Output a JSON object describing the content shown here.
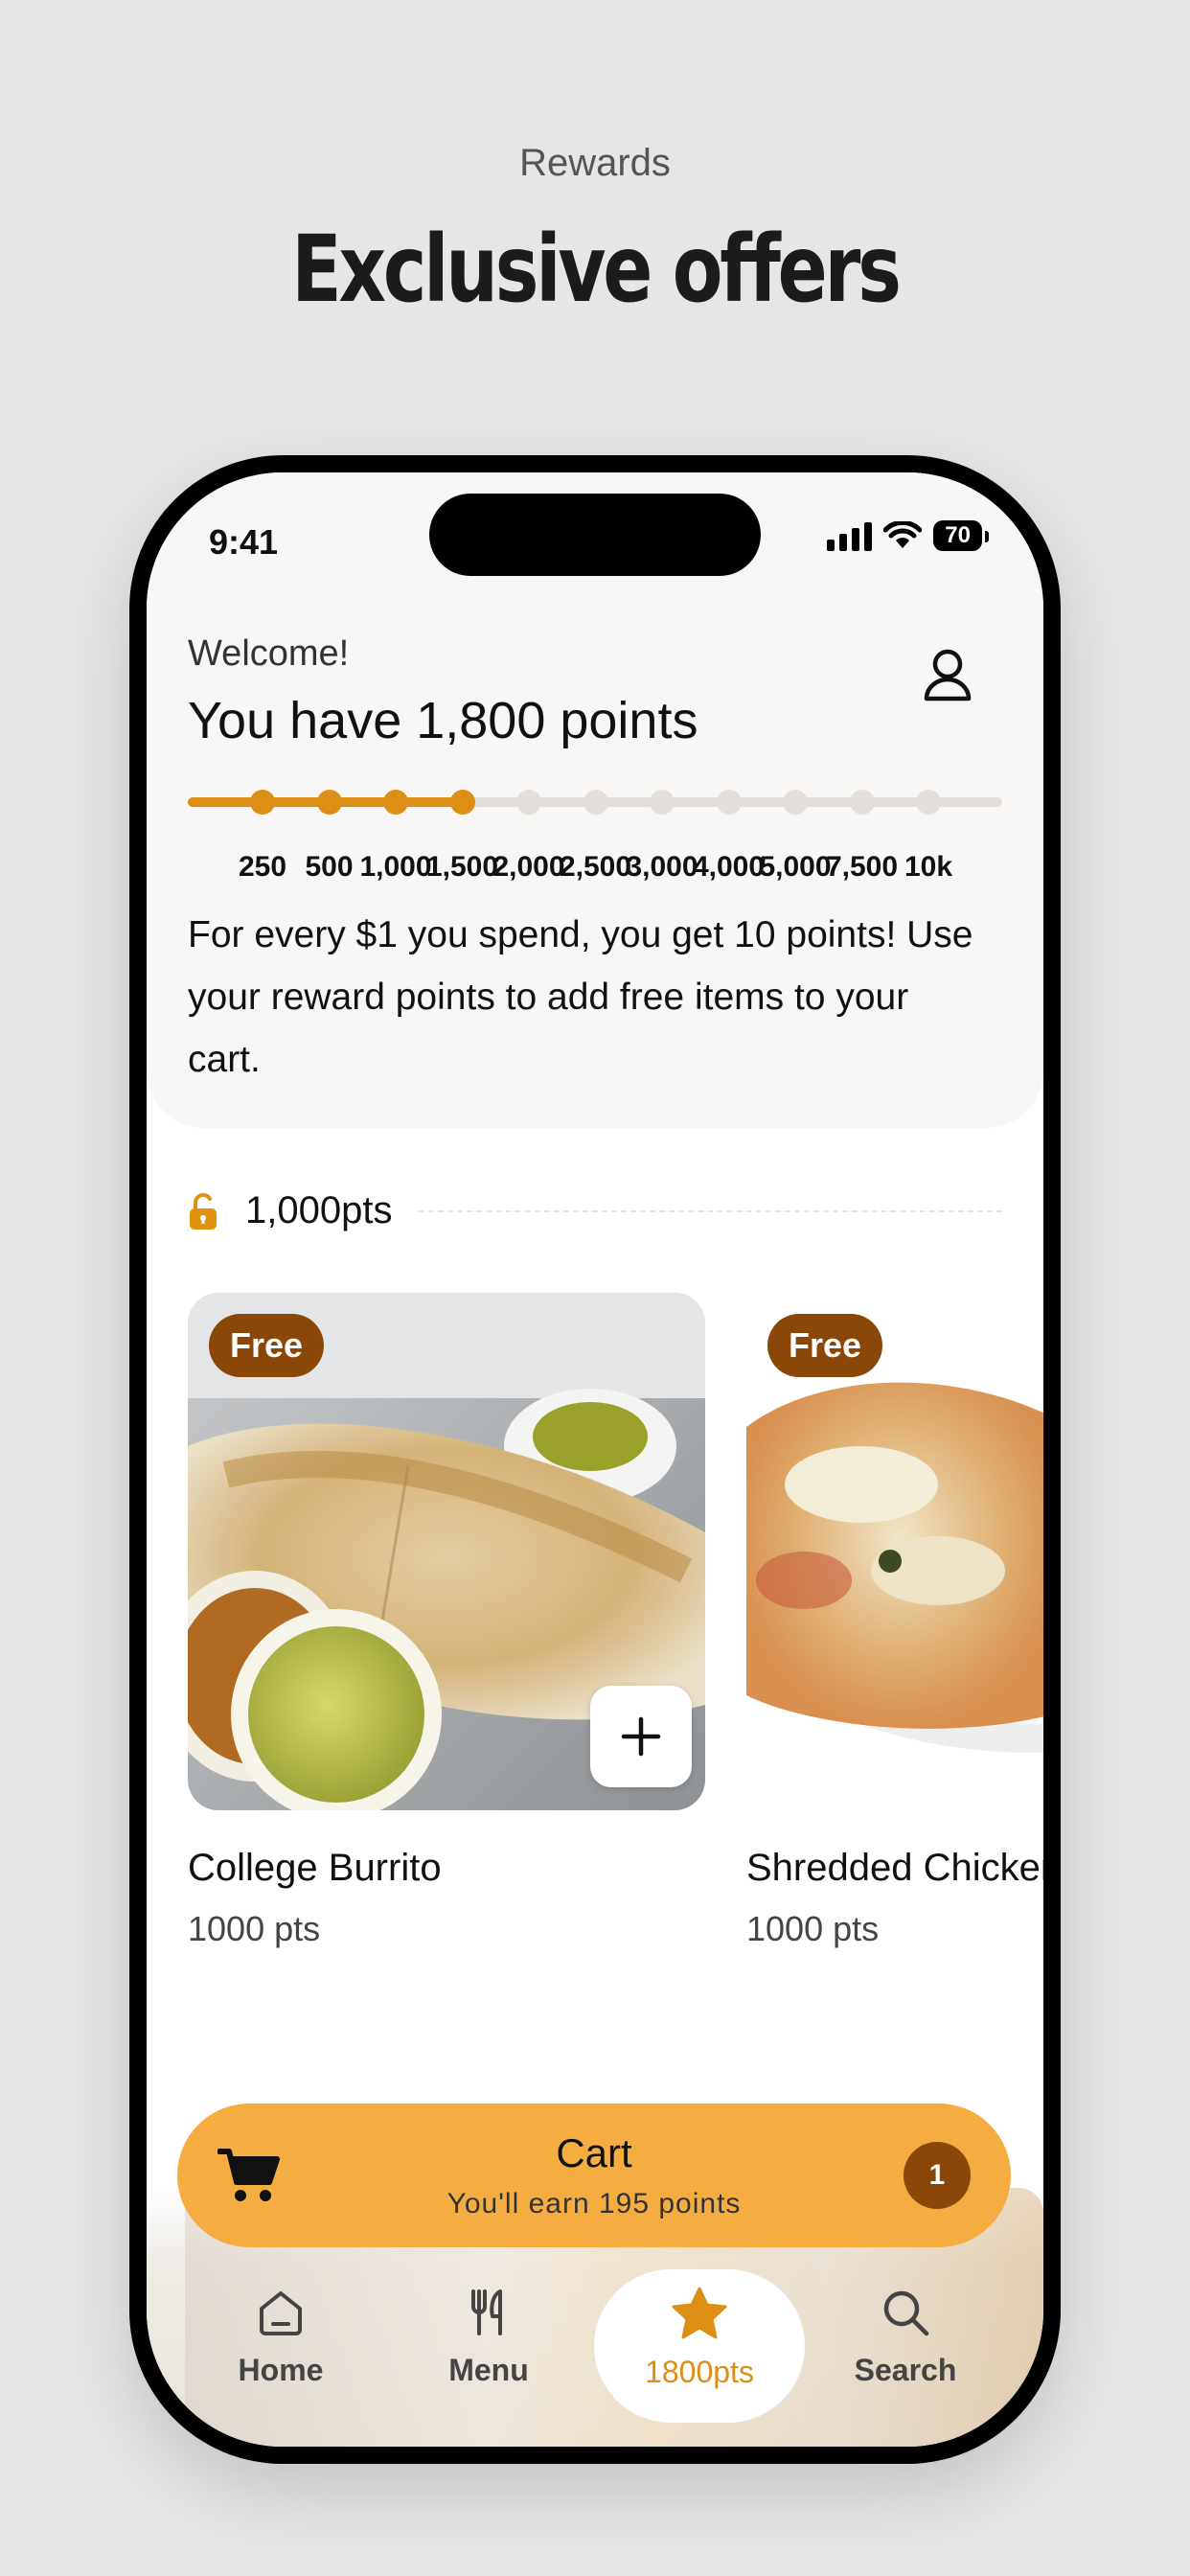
{
  "page": {
    "eyebrow": "Rewards",
    "headline": "Exclusive offers"
  },
  "status_bar": {
    "time": "9:41",
    "battery": "70"
  },
  "header": {
    "welcome": "Welcome!",
    "points_title": "You have 1,800 points",
    "description": "For every $1 you spend, you get 10 points! Use your reward points to add free items to your cart.",
    "progress_points": 1800,
    "milestones": [
      "250",
      "500",
      "1,000",
      "1,500",
      "2,000",
      "2,500",
      "3,000",
      "4,000",
      "5,000",
      "7,500",
      "10k"
    ],
    "milestones_reached": 4,
    "accent_color": "#dd8e15"
  },
  "tier": {
    "label": "1,000pts",
    "icon": "lock-open-icon"
  },
  "items": [
    {
      "badge": "Free",
      "name": "College Burrito",
      "points": "1000 pts"
    },
    {
      "badge": "Free",
      "name": "Shredded Chicken",
      "points": "1000 pts"
    }
  ],
  "cart": {
    "title": "Cart",
    "subtitle": "You'll earn 195 points",
    "count": "1",
    "color": "#f5ad42"
  },
  "nav": {
    "items": [
      {
        "label": "Home",
        "icon": "home-icon"
      },
      {
        "label": "Menu",
        "icon": "fork-knife-icon"
      },
      {
        "label": "1800pts",
        "icon": "star-icon",
        "active": true
      },
      {
        "label": "Search",
        "icon": "search-icon"
      }
    ]
  }
}
